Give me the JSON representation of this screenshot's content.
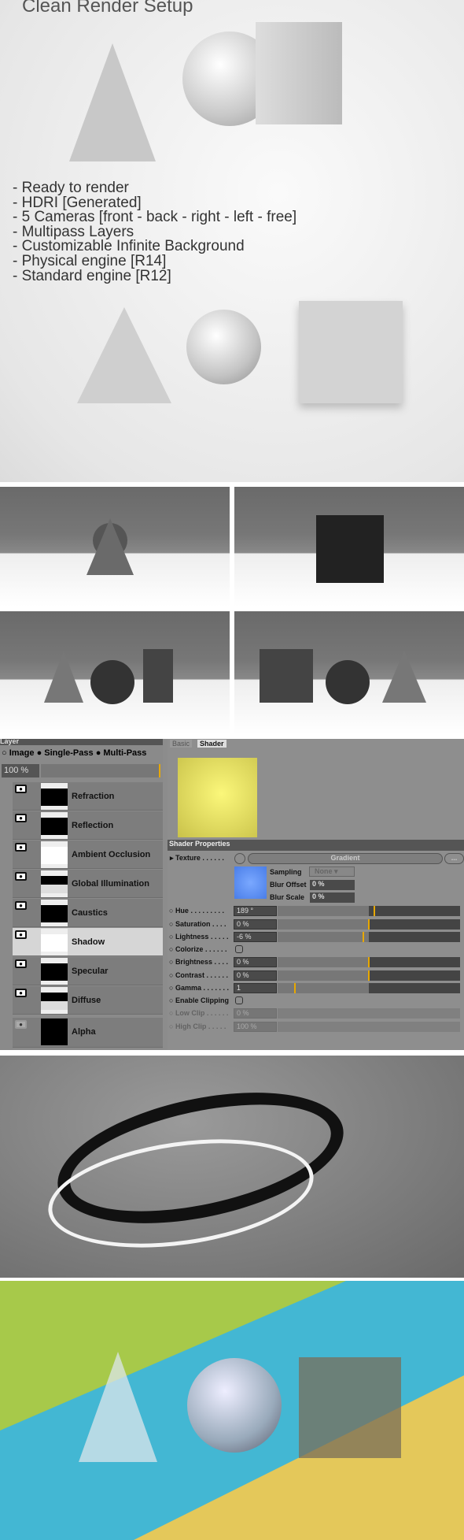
{
  "header": {
    "title": "Clean Render Setup"
  },
  "features": [
    "- Ready to render",
    "- HDRI [Generated]",
    "- 5 Cameras [front - back - right - left - free]",
    "- Multipass Layers",
    "- Customizable Infinite Background",
    "- Physical engine  [R14]",
    "- Standard engine [R12]"
  ],
  "layer_panel": {
    "title": "Layer",
    "modes": [
      "Image",
      "Single-Pass",
      "Multi-Pass"
    ],
    "selected_mode": "Image",
    "opacity": "100 %",
    "layers": [
      {
        "name": "Refraction",
        "visible": true
      },
      {
        "name": "Reflection",
        "visible": true
      },
      {
        "name": "Ambient Occlusion",
        "visible": true
      },
      {
        "name": "Global Illumination",
        "visible": true
      },
      {
        "name": "Caustics",
        "visible": true
      },
      {
        "name": "Shadow",
        "visible": true,
        "selected": true
      },
      {
        "name": "Specular",
        "visible": true
      },
      {
        "name": "Diffuse",
        "visible": true
      },
      {
        "name": "Alpha",
        "visible": false
      }
    ]
  },
  "shader_panel": {
    "tabs": [
      "Basic",
      "Shader"
    ],
    "active_tab": "Shader",
    "preview_color": "#e8e060",
    "section": "Shader Properties",
    "texture_label": "Texture . . . . . .",
    "texture_value": "Gradient",
    "more_label": "...",
    "texture_swatch": "#5a8ef0",
    "sampling_label": "Sampling",
    "sampling_value": "None",
    "blur_offset_label": "Blur Offset",
    "blur_offset": "0 %",
    "blur_scale_label": "Blur Scale",
    "blur_scale": "0 %",
    "props": [
      {
        "label": "Hue . . . . . . . . .",
        "value": "189 °",
        "level": 0.53
      },
      {
        "label": "Saturation . . . .",
        "value": "0 %",
        "level": 0.5
      },
      {
        "label": "Lightness . . . . .",
        "value": "-6 %",
        "level": 0.47
      },
      {
        "label": "Brightness . . . .",
        "value": "0 %",
        "level": 0.5
      },
      {
        "label": "Contrast . . . . . .",
        "value": "0 %",
        "level": 0.5
      },
      {
        "label": "Gamma . . . . . . .",
        "value": "1",
        "level": 0.09
      }
    ],
    "colorize_label": "Colorize . . . . . .",
    "clipping_label": "Enable Clipping",
    "low_clip_label": "Low Clip . . . . . .",
    "low_clip": "0 %",
    "high_clip_label": "High Clip . . . . .",
    "high_clip": "100 %"
  }
}
